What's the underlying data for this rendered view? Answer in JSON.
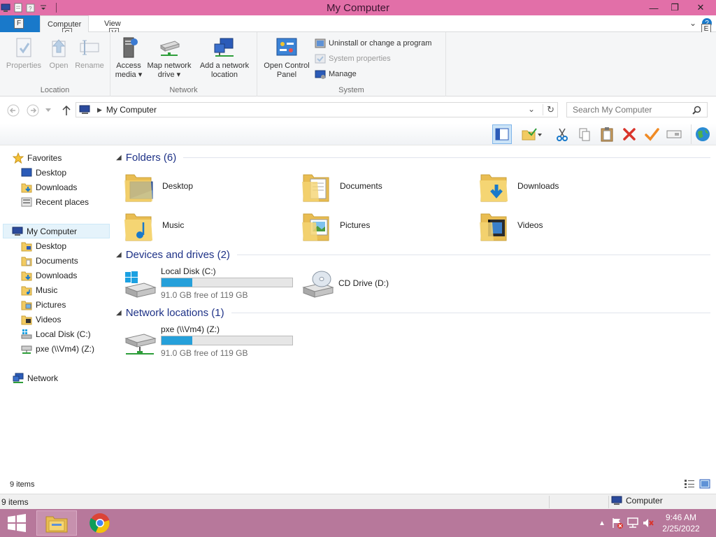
{
  "window": {
    "title": "My Computer",
    "min_glyph": "—",
    "max_glyph": "❐",
    "close_glyph": "✕"
  },
  "ribbon_tabs": {
    "file": "F",
    "computer": "Computer",
    "computer_key": "C",
    "view": "View",
    "view_key": "V",
    "help_key": "E",
    "expand_glyph": "⌄",
    "help_glyph": "?"
  },
  "ribbon": {
    "location": {
      "label": "Location",
      "properties": "Properties",
      "open": "Open",
      "rename": "Rename"
    },
    "network": {
      "label": "Network",
      "access_media_1": "Access",
      "access_media_2": "media ▾",
      "map_drive_1": "Map network",
      "map_drive_2": "drive ▾",
      "add_location_1": "Add a network",
      "add_location_2": "location"
    },
    "system": {
      "label": "System",
      "control_panel_1": "Open Control",
      "control_panel_2": "Panel",
      "uninstall": "Uninstall or change a program",
      "system_properties": "System properties",
      "manage": "Manage"
    }
  },
  "address": {
    "path": "My Computer",
    "search_placeholder": "Search My Computer"
  },
  "nav": {
    "favorites": "Favorites",
    "fav_desktop": "Desktop",
    "fav_downloads": "Downloads",
    "fav_recent": "Recent places",
    "my_computer": "My Computer",
    "desktop": "Desktop",
    "documents": "Documents",
    "downloads": "Downloads",
    "music": "Music",
    "pictures": "Pictures",
    "videos": "Videos",
    "local_disk": "Local Disk (C:)",
    "pxe": "pxe (\\\\Vm4) (Z:)",
    "network": "Network"
  },
  "content": {
    "folders_header": "Folders (6)",
    "folders": {
      "desktop": "Desktop",
      "documents": "Documents",
      "downloads": "Downloads",
      "music": "Music",
      "pictures": "Pictures",
      "videos": "Videos"
    },
    "devices_header": "Devices and drives (2)",
    "local_disk": {
      "name": "Local Disk (C:)",
      "free": "91.0 GB free of 119 GB",
      "used_fraction": 0.235
    },
    "cd_drive": {
      "name": "CD Drive (D:)"
    },
    "network_header": "Network locations (1)",
    "pxe": {
      "name": "pxe (\\\\Vm4) (Z:)",
      "free": "91.0 GB free of 119 GB",
      "used_fraction": 0.235
    }
  },
  "status": {
    "items": "9 items",
    "details_items": "9 items",
    "zone": "Computer"
  },
  "taskbar": {
    "time": "9:46 AM",
    "date": "2/25/2022",
    "tray_arrow": "▲"
  },
  "colors": {
    "titlebar": "#e26fa8",
    "file_tab": "#1979ca",
    "taskbar": "#b7789b",
    "header_text": "#1e3287",
    "drive_bar": "#26a0da"
  }
}
